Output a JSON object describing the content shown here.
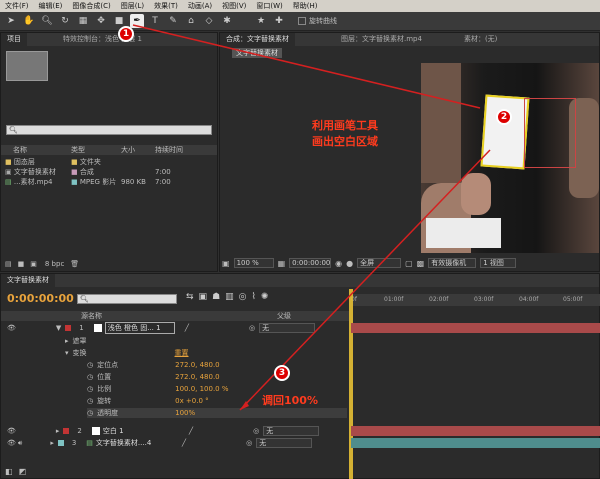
{
  "menu": [
    "文件(F)",
    "编辑(E)",
    "图像合成(C)",
    "图层(L)",
    "效果(T)",
    "动画(A)",
    "视图(V)",
    "窗口(W)",
    "帮助(H)"
  ],
  "toolbar": {
    "curve_label": "旋转曲线"
  },
  "project": {
    "tabs": [
      "项目",
      "特效控制台：浅色 图层 1",
      "图层 1"
    ],
    "columns": {
      "name": "名称",
      "type": "类型",
      "size": "大小",
      "duration": "持续时间"
    },
    "items": [
      {
        "name": "固态层",
        "type": "文件夹",
        "size": "",
        "dur": ""
      },
      {
        "name": "文字替换素材",
        "type": "合成",
        "size": "",
        "dur": "7:00"
      },
      {
        "name": "...素材.mp4",
        "type": "MPEG 影片",
        "size": "980 KB",
        "dur": "7:00"
      }
    ],
    "bpc": "8 bpc"
  },
  "viewer": {
    "tabs": [
      "合成：文字替换素材",
      "图层：文字替换素材.mp4",
      "素材：(无)"
    ],
    "subtab": "文字替换素材",
    "zoom": "100 %",
    "time": "0:00:00:00",
    "res": "全屏",
    "camera": "有效摄像机",
    "views": "1 视图"
  },
  "timeline": {
    "tab": "文字替换素材",
    "timecode": "0:00:00:00",
    "ruler": [
      "0f",
      "01:00f",
      "02:00f",
      "03:00f",
      "04:00f",
      "05:00f"
    ],
    "header": "源名称",
    "parent": "父级",
    "layers": [
      {
        "num": "1",
        "name": "浅色 橙色 固... 1",
        "color": "#c23434",
        "parent": "无"
      },
      {
        "num": "2",
        "name": "空白 1",
        "color": "#c23434",
        "parent": "无"
      },
      {
        "num": "3",
        "name": "文字替换素材....4",
        "color": "#7fc3c3",
        "parent": "无"
      }
    ],
    "masks": "遮罩",
    "transform": "变换",
    "reset": "重置",
    "props": [
      {
        "name": "定位点",
        "value": "272.0, 480.0"
      },
      {
        "name": "位置",
        "value": "272.0, 480.0"
      },
      {
        "name": "比例",
        "value": "100.0, 100.0 %"
      },
      {
        "name": "旋转",
        "value": "0x +0.0 °"
      },
      {
        "name": "透明度",
        "value": "100%"
      }
    ]
  },
  "annotations": {
    "a1": "1",
    "a2": "2",
    "a3": "3",
    "text2": "利用画笔工具\n画出空白区域",
    "text3": "调回100%"
  }
}
